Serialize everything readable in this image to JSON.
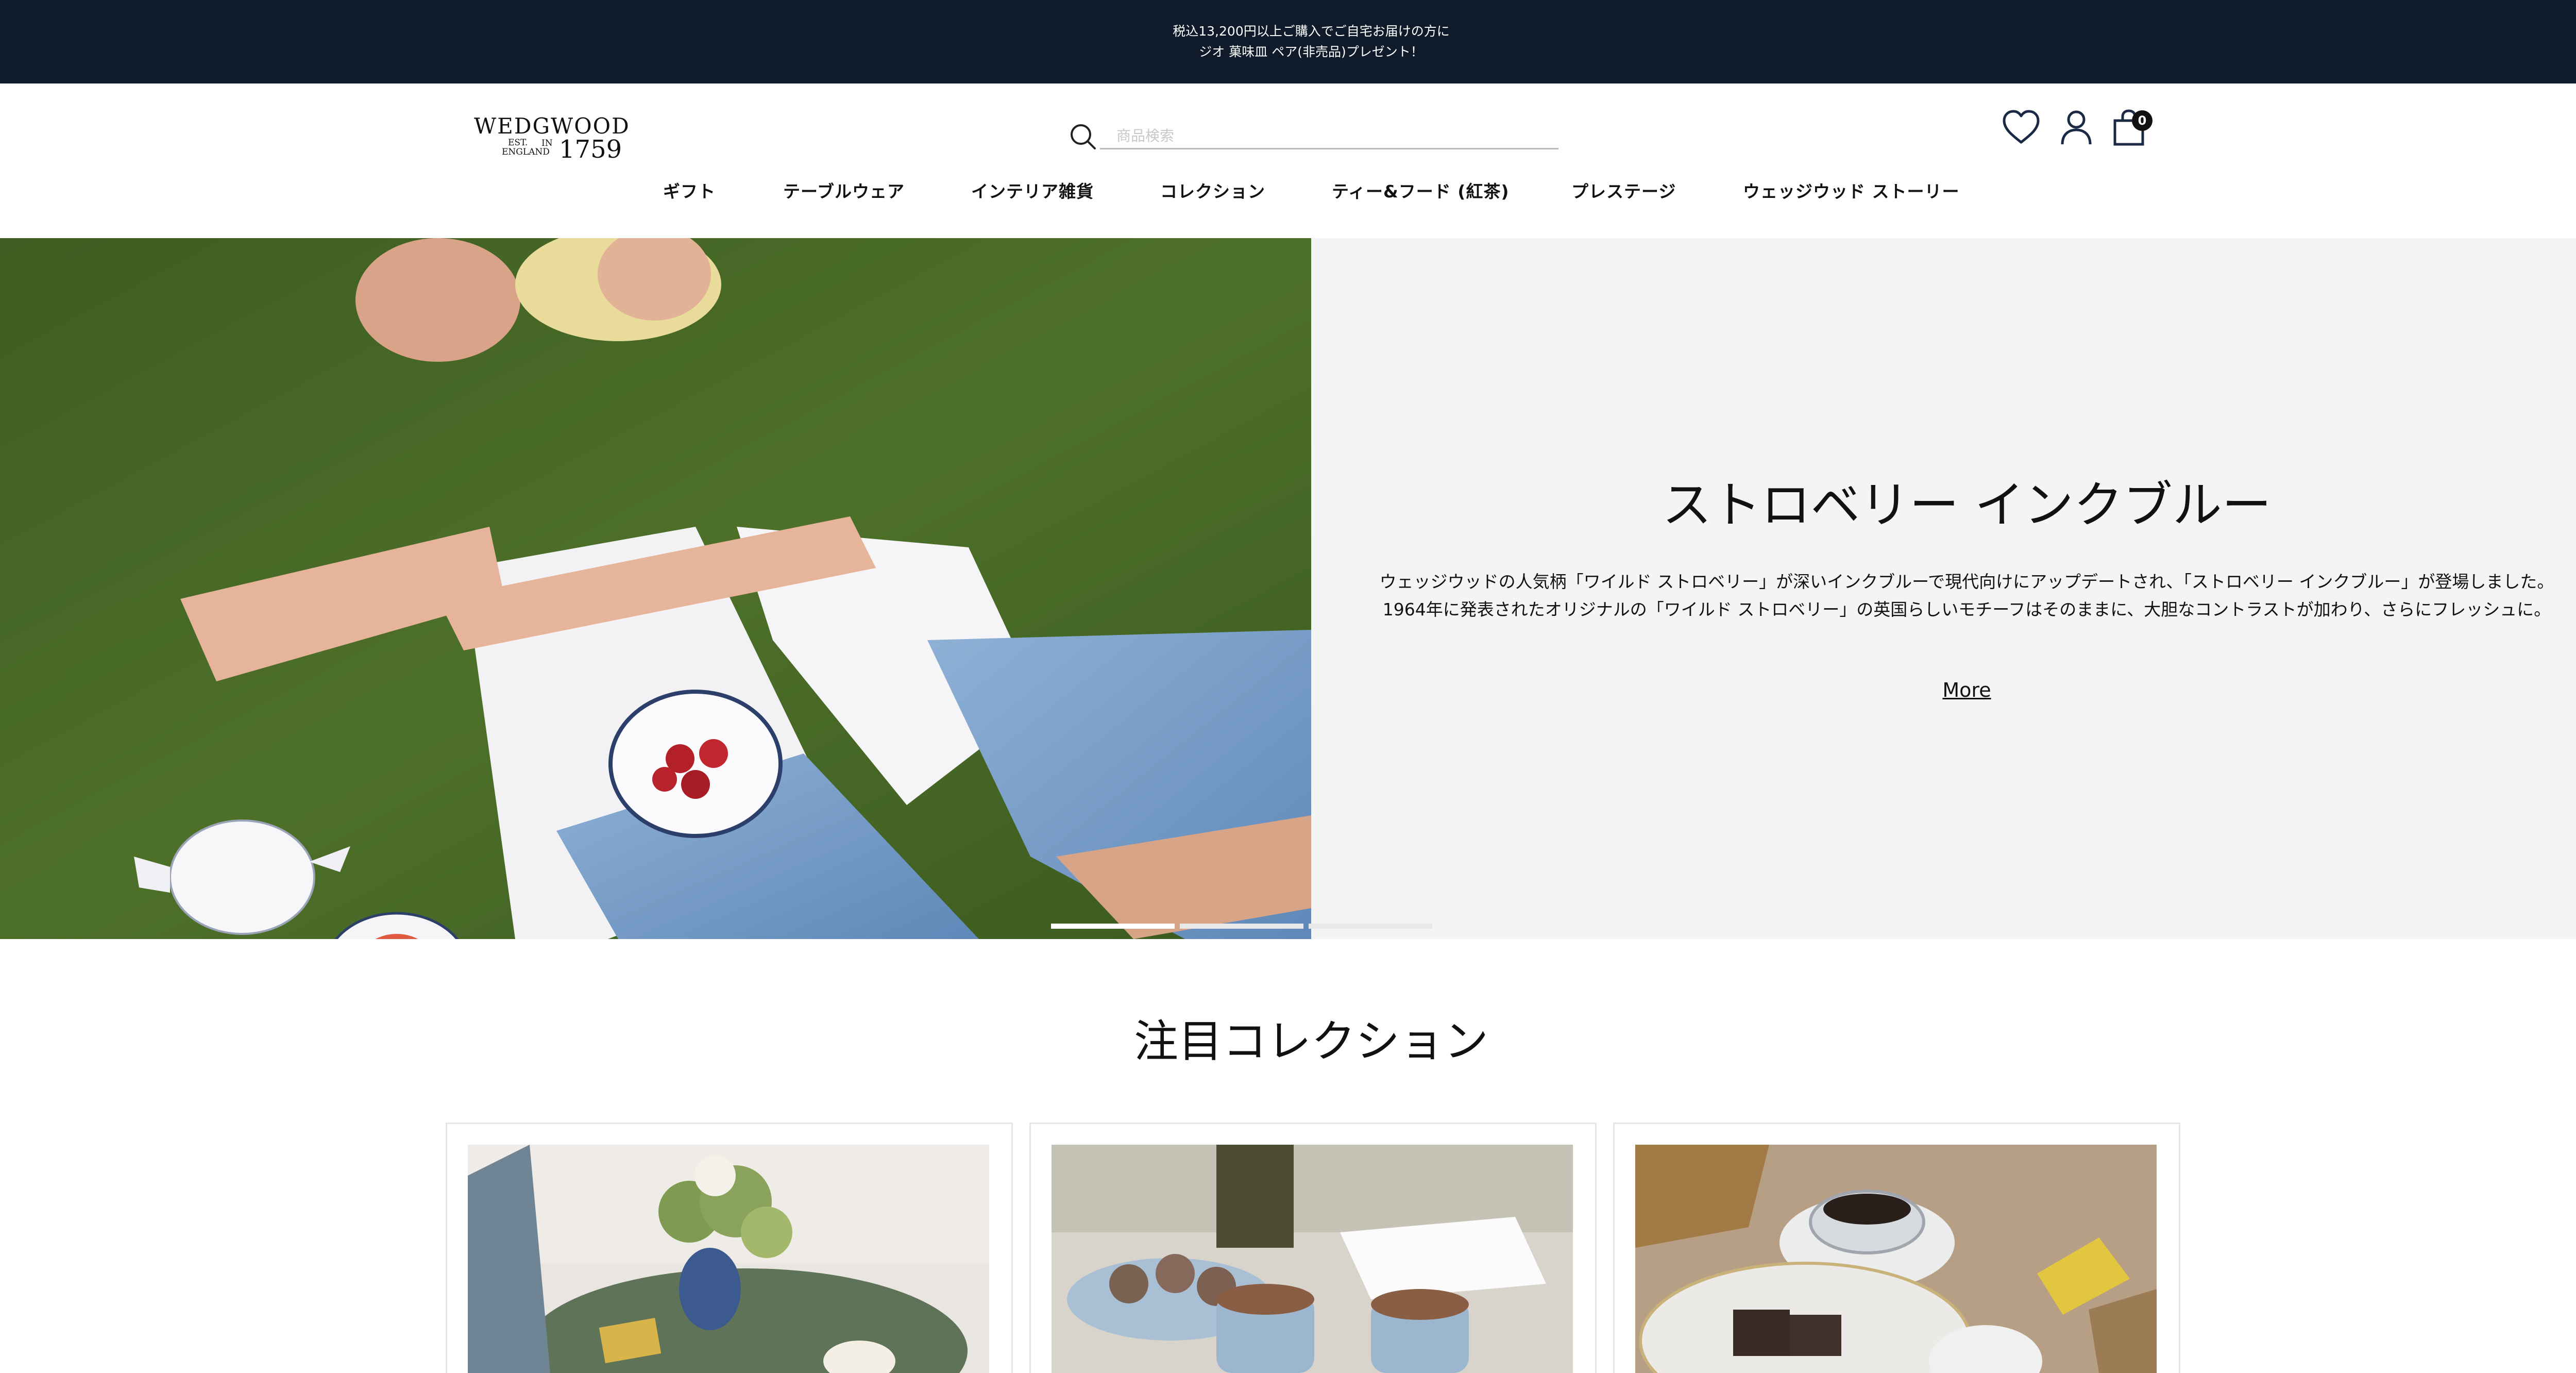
{
  "promo": {
    "line1": "税込13,200円以上ご購入でご自宅お届けの方に",
    "line2": "ジオ 菓味皿 ペア(非売品)プレゼント！"
  },
  "logo": {
    "word": "WEDGWOOD",
    "est": "EST.",
    "england": "ENGLAND",
    "in": "IN",
    "year": "1759"
  },
  "search": {
    "placeholder": "商品検索"
  },
  "icons": {
    "wishlist": "heart-icon",
    "account": "user-icon",
    "cart": "shopping-bag-icon",
    "search": "search-icon"
  },
  "cart": {
    "count": "0"
  },
  "nav": {
    "items": [
      {
        "label": "ギフト"
      },
      {
        "label": "テーブルウェア"
      },
      {
        "label": "インテリア雑貨"
      },
      {
        "label": "コレクション"
      },
      {
        "label": "ティー&フード (紅茶)"
      },
      {
        "label": "プレステージ"
      },
      {
        "label": "ウェッジウッド ストーリー"
      }
    ]
  },
  "hero": {
    "title": "ストロベリー インクブルー",
    "desc1": "ウェッジウッドの人気柄「ワイルド ストロベリー」が深いインクブルーで現代向けにアップデートされ、「ストロベリー インクブルー」が登場しました。",
    "desc2": "1964年に発表されたオリジナルの「ワイルド ストロベリー」の英国らしいモチーフはそのままに、大胆なコントラストが加わり、さらにフレッシュに。",
    "cta": "More"
  },
  "featured": {
    "title": "注目コレクション"
  },
  "colors": {
    "promo_bg": "#0f1b2a",
    "panel_bg": "#f4f4f5"
  }
}
